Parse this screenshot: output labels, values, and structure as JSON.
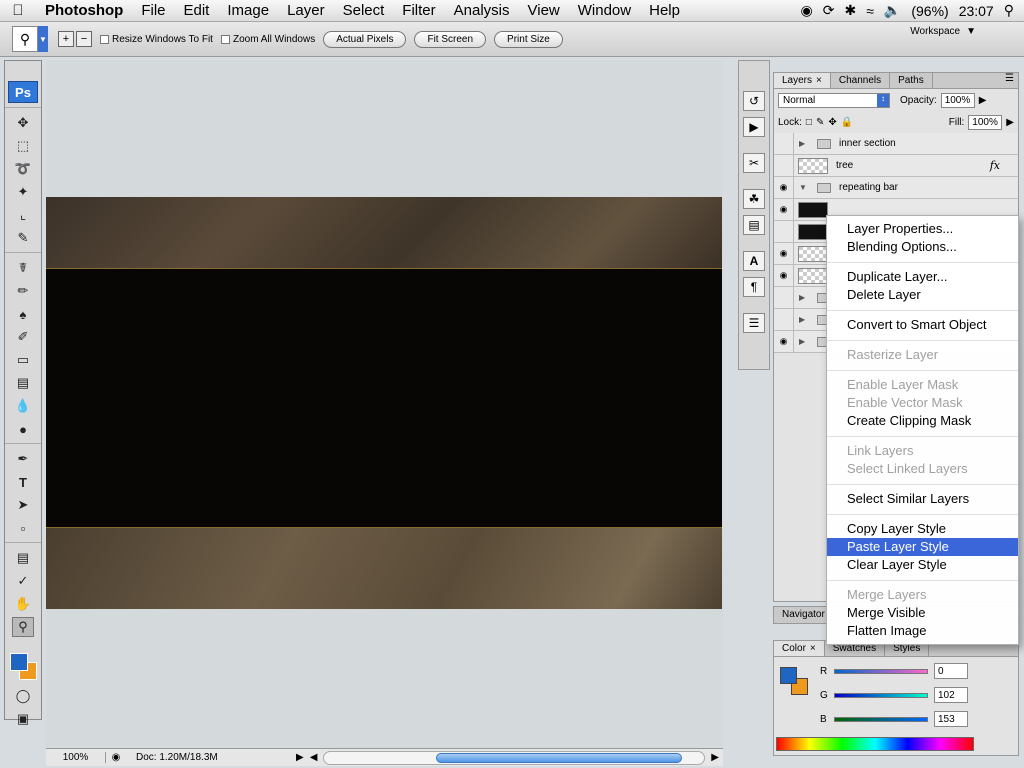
{
  "menubar": {
    "app": "Photoshop",
    "items": [
      "File",
      "Edit",
      "Image",
      "Layer",
      "Select",
      "Filter",
      "Analysis",
      "View",
      "Window",
      "Help"
    ],
    "battery": "(96%)",
    "clock": "23:07"
  },
  "options": {
    "resize_windows": "Resize Windows To Fit",
    "zoom_all": "Zoom All Windows",
    "actual_pixels": "Actual Pixels",
    "fit_screen": "Fit Screen",
    "print_size": "Print Size",
    "workspace": "Workspace"
  },
  "toolbox": {
    "logo": "Ps"
  },
  "status": {
    "zoom": "100%",
    "doc": "Doc: 1.20M/18.3M"
  },
  "layers": {
    "tabs": [
      "Layers",
      "Channels",
      "Paths"
    ],
    "blend_mode": "Normal",
    "opacity_label": "Opacity:",
    "opacity": "100%",
    "lock_label": "Lock:",
    "fill_label": "Fill:",
    "fill": "100%",
    "rows": [
      {
        "name": "inner section",
        "type": "group",
        "visible": false
      },
      {
        "name": "tree",
        "type": "layer",
        "visible": false,
        "fx": "fx"
      },
      {
        "name": "repeating bar",
        "type": "group",
        "visible": true
      }
    ]
  },
  "navigator": {
    "tab": "Navigator"
  },
  "color_panel": {
    "tabs": [
      "Color",
      "Swatches",
      "Styles"
    ],
    "channels": [
      {
        "label": "R",
        "value": "0"
      },
      {
        "label": "G",
        "value": "102"
      },
      {
        "label": "B",
        "value": "153"
      }
    ],
    "foreground": "#1f66c2",
    "background": "#ee9a20"
  },
  "context_menu": {
    "groups": [
      [
        {
          "label": "Layer Properties...",
          "enabled": true
        },
        {
          "label": "Blending Options...",
          "enabled": true
        }
      ],
      [
        {
          "label": "Duplicate Layer...",
          "enabled": true
        },
        {
          "label": "Delete Layer",
          "enabled": true
        }
      ],
      [
        {
          "label": "Convert to Smart Object",
          "enabled": true
        }
      ],
      [
        {
          "label": "Rasterize Layer",
          "enabled": false
        }
      ],
      [
        {
          "label": "Enable Layer Mask",
          "enabled": false
        },
        {
          "label": "Enable Vector Mask",
          "enabled": false
        },
        {
          "label": "Create Clipping Mask",
          "enabled": true
        }
      ],
      [
        {
          "label": "Link Layers",
          "enabled": false
        },
        {
          "label": "Select Linked Layers",
          "enabled": false
        }
      ],
      [
        {
          "label": "Select Similar Layers",
          "enabled": true
        }
      ],
      [
        {
          "label": "Copy Layer Style",
          "enabled": true
        },
        {
          "label": "Paste Layer Style",
          "enabled": true,
          "highlighted": true
        },
        {
          "label": "Clear Layer Style",
          "enabled": true
        }
      ],
      [
        {
          "label": "Merge Layers",
          "enabled": false
        },
        {
          "label": "Merge Visible",
          "enabled": true
        },
        {
          "label": "Flatten Image",
          "enabled": true
        }
      ]
    ]
  }
}
